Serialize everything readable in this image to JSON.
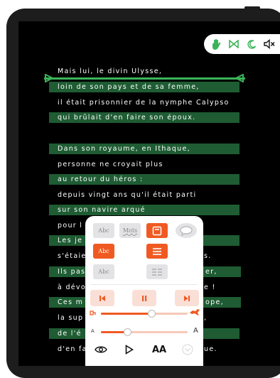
{
  "toolbar": {
    "icons": [
      "hand-icon",
      "bowtie-icon",
      "moon-icon",
      "mute-icon"
    ],
    "accent": "#3cb35a"
  },
  "text": {
    "lines": [
      "Mais lui,  le divin Ulysse,",
      "loin de son pays et de sa femme,",
      "il était prisonnier de la nymphe Calypso",
      "qui brûlait d'en faire son époux.",
      "",
      "Dans son royaume, en Ithaque,",
      "personne ne croyait plus",
      "au retour du héros :",
      "depuis vingt ans qu'il était parti",
      "sur son navire arqué",
      "pour l",
      "Les je",
      "s'étaie",
      "Ils pas",
      "à dévo",
      "Ces m",
      "la sup",
      "de l'é",
      "d'en fa"
    ],
    "right_fragments": [
      "s.",
      "er,",
      "e !",
      "ope,",
      ",",
      "ue."
    ],
    "highlight_color": "#1f5c33"
  },
  "panel": {
    "style_buttons": [
      "Abc",
      "Mots",
      "",
      "",
      "Abc",
      "",
      "Abc",
      ""
    ],
    "volume_label_left": "",
    "font_small": "A",
    "font_large": "A",
    "aa_label": "AA",
    "speed_position": 0.58,
    "font_size_position": 0.3,
    "accent": "#f05a22"
  }
}
